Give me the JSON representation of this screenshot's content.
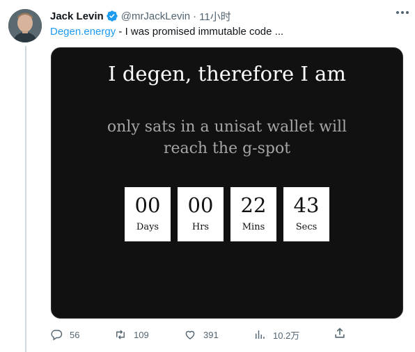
{
  "tweet": {
    "author": {
      "display_name": "Jack Levin",
      "handle": "@mrJackLevin",
      "verified": true
    },
    "separator": "·",
    "time": "11小时",
    "text": {
      "link": "Degen.energy",
      "body": " - I was promised immutable code ..."
    },
    "media": {
      "headline": "I degen, therefore I am",
      "subline": "only sats in a unisat wallet will reach the g-spot",
      "countdown": [
        {
          "value": "00",
          "label": "Days"
        },
        {
          "value": "00",
          "label": "Hrs"
        },
        {
          "value": "22",
          "label": "Mins"
        },
        {
          "value": "43",
          "label": "Secs"
        }
      ]
    },
    "actions": {
      "replies": "56",
      "retweets": "109",
      "likes": "391",
      "views": "10.2万"
    }
  },
  "colors": {
    "accent": "#1d9bf0",
    "muted": "#536471",
    "media_bg": "#111111"
  },
  "icons": [
    "verified-icon",
    "more-icon",
    "reply-icon",
    "retweet-icon",
    "like-icon",
    "views-icon",
    "share-icon"
  ]
}
